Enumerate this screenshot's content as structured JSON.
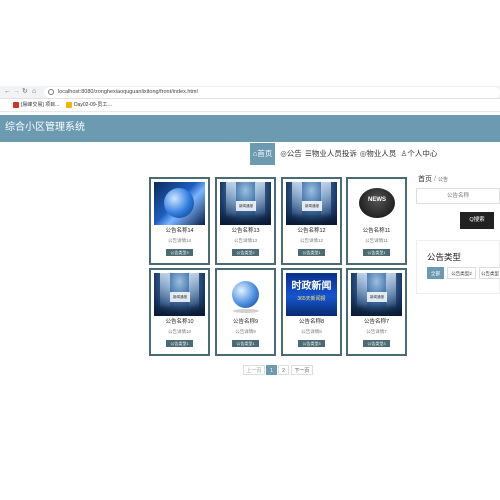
{
  "browser": {
    "url": "localhost:8080/zonghexiaoquguanlixitong/front/index.html",
    "bookmarks": [
      {
        "label": "[易峰交易] 项目...",
        "color": "#d93025"
      },
      {
        "label": "Day02-09-员工…",
        "color": "#f2b400"
      }
    ]
  },
  "header": {
    "title": "综合小区管理系统"
  },
  "nav": {
    "items": [
      {
        "label": "⌂首页",
        "active": true
      },
      {
        "label": "◎公告",
        "active": false
      },
      {
        "label": "☰物业人员投诉",
        "active": false
      },
      {
        "label": "◎物业人员",
        "active": false
      },
      {
        "label": "♙个人中心",
        "active": false
      }
    ]
  },
  "cards": [
    {
      "title": "公告名称14",
      "detail": "公告详情14",
      "tag": "公告类型3",
      "image": "globe-blue"
    },
    {
      "title": "公告名称13",
      "detail": "公告详情13",
      "tag": "公告类型2",
      "image": "stage"
    },
    {
      "title": "公告名称12",
      "detail": "公告详情12",
      "tag": "公告类型1",
      "image": "stage"
    },
    {
      "title": "公告名称11",
      "detail": "公告详情11",
      "tag": "公告类型1",
      "image": "news"
    },
    {
      "title": "公告名称10",
      "detail": "公告详情10",
      "tag": "公告类型1",
      "image": "stage"
    },
    {
      "title": "公告名称9",
      "detail": "公告详情9",
      "tag": "公告类型1",
      "image": "globe-3d"
    },
    {
      "title": "公告名称8",
      "detail": "公告详情8",
      "tag": "公告类型3",
      "image": "shizheng"
    },
    {
      "title": "公告名称7",
      "detail": "公告详情7",
      "tag": "公告类型3",
      "image": "stage"
    }
  ],
  "images": {
    "stage_sign": "新闻通报",
    "news_text": "NEWS",
    "shizheng_big": "时政新闻",
    "shizheng_small": "365天新闻报"
  },
  "pagination": {
    "prev": "上一页",
    "pages": [
      "1",
      "2"
    ],
    "active": "1",
    "next": "下一页"
  },
  "sidebar": {
    "breadcrumb_home": "首页",
    "breadcrumb_sep": "/",
    "breadcrumb_current": "公告",
    "search_placeholder": "公告名称",
    "search_button": "Q搜索",
    "types_title": "公告类型",
    "types": [
      {
        "label": "全部",
        "active": true
      },
      {
        "label": "公告类型2",
        "active": false
      },
      {
        "label": "公告类型",
        "active": false
      }
    ]
  }
}
